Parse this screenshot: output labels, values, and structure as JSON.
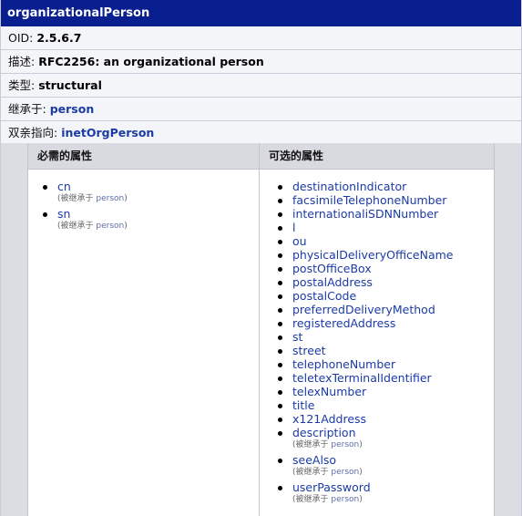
{
  "header": {
    "title": "organizationalPerson"
  },
  "info": {
    "oid_label": "OID:",
    "oid_value": "2.5.6.7",
    "desc_label": "描述:",
    "desc_value": "RFC2256: an organizational person",
    "type_label": "类型:",
    "type_value": "structural",
    "inherits_label": "继承于:",
    "inherits_value": "person",
    "parent_label": "双亲指向:",
    "parent_value": "inetOrgPerson"
  },
  "required": {
    "heading": "必需的属性",
    "items": [
      {
        "name": "cn",
        "inherited_prefix": "(被继承于 ",
        "inherited_from": "person",
        "inherited_suffix": ")"
      },
      {
        "name": "sn",
        "inherited_prefix": "(被继承于 ",
        "inherited_from": "person",
        "inherited_suffix": ")"
      }
    ]
  },
  "optional": {
    "heading": "可选的属性",
    "items": [
      {
        "name": "destinationIndicator"
      },
      {
        "name": "facsimileTelephoneNumber"
      },
      {
        "name": "internationaliSDNNumber"
      },
      {
        "name": "l"
      },
      {
        "name": "ou"
      },
      {
        "name": "physicalDeliveryOfficeName"
      },
      {
        "name": "postOfficeBox"
      },
      {
        "name": "postalAddress"
      },
      {
        "name": "postalCode"
      },
      {
        "name": "preferredDeliveryMethod"
      },
      {
        "name": "registeredAddress"
      },
      {
        "name": "st"
      },
      {
        "name": "street"
      },
      {
        "name": "telephoneNumber"
      },
      {
        "name": "teletexTerminalIdentifier"
      },
      {
        "name": "telexNumber"
      },
      {
        "name": "title"
      },
      {
        "name": "x121Address"
      },
      {
        "name": "description",
        "inherited_prefix": "(被继承于 ",
        "inherited_from": "person",
        "inherited_suffix": ")"
      },
      {
        "name": "seeAlso",
        "inherited_prefix": "(被继承于 ",
        "inherited_from": "person",
        "inherited_suffix": ")"
      },
      {
        "name": "userPassword",
        "inherited_prefix": "(被继承于 ",
        "inherited_from": "person",
        "inherited_suffix": ")"
      }
    ]
  }
}
